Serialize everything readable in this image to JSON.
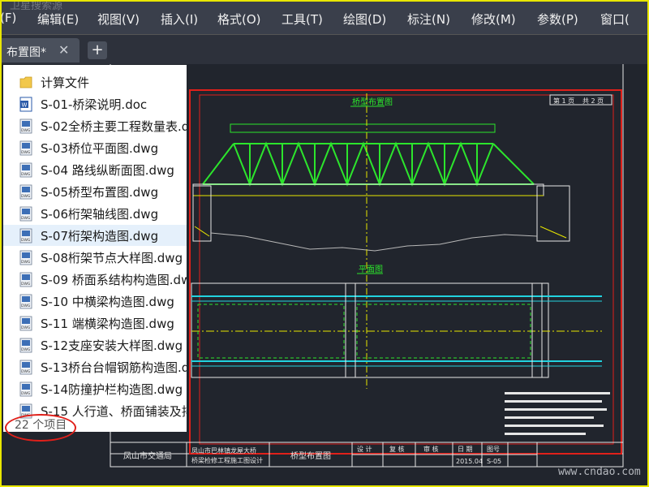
{
  "app": {
    "title": "卫星搜索源"
  },
  "menu": [
    "(F)",
    "编辑(E)",
    "视图(V)",
    "插入(I)",
    "格式(O)",
    "工具(T)",
    "绘图(D)",
    "标注(N)",
    "修改(M)",
    "参数(P)",
    "窗口("
  ],
  "tab": {
    "label": "布置图*",
    "close": "✕",
    "new": "+"
  },
  "files": [
    {
      "name": "计算文件",
      "type": "folder"
    },
    {
      "name": "S-01-桥梁说明.doc",
      "type": "doc"
    },
    {
      "name": "S-02全桥主要工程数量表.d",
      "type": "dwg"
    },
    {
      "name": "S-03桥位平面图.dwg",
      "type": "dwg"
    },
    {
      "name": "S-04 路线纵断面图.dwg",
      "type": "dwg"
    },
    {
      "name": "S-05桥型布置图.dwg",
      "type": "dwg"
    },
    {
      "name": "S-06桁架轴线图.dwg",
      "type": "dwg"
    },
    {
      "name": "S-07桁架构造图.dwg",
      "type": "dwg",
      "selected": true
    },
    {
      "name": "S-08桁架节点大样图.dwg",
      "type": "dwg"
    },
    {
      "name": "S-09 桥面系结构构造图.dwg",
      "type": "dwg"
    },
    {
      "name": "S-10 中横梁构造图.dwg",
      "type": "dwg"
    },
    {
      "name": "S-11 端横梁构造图.dwg",
      "type": "dwg"
    },
    {
      "name": "S-12支座安装大样图.dwg",
      "type": "dwg"
    },
    {
      "name": "S-13桥台台帽钢筋构造图.d",
      "type": "dwg"
    },
    {
      "name": "S-14防撞护栏构造图.dwg",
      "type": "dwg"
    },
    {
      "name": "S-15 人行道、桥面铺装及排",
      "type": "dwg"
    }
  ],
  "status": {
    "item_count": "22 个项目"
  },
  "drawing": {
    "title_elevation": "桥型布置图",
    "title_plan": "平面图",
    "sheet": [
      "第 1 页",
      "共 2 页"
    ],
    "titleblock": {
      "owner": "凤山市交通局",
      "project_line1": "凤山市巴林镇龙屋大桥",
      "project_line2": "桥梁检修工程施工图设计",
      "drawing_name": "桥型布置图",
      "headers": [
        "设 计",
        "复 核",
        "审 核",
        "日 期",
        "图号"
      ],
      "date": "2015.04",
      "number": "S-05"
    }
  },
  "watermark": "www.cndao.com",
  "colors": {
    "frame": "#e8e600",
    "truss": "#2ce52c",
    "border_red": "#e0201a",
    "cyan": "#22d3e0",
    "highlight": "#e0201a"
  }
}
